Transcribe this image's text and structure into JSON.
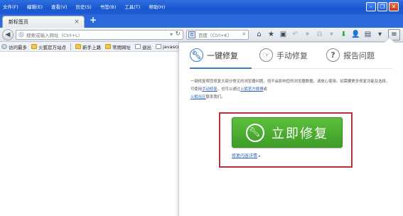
{
  "menu": [
    "文件(F)",
    "编辑(E)",
    "查看(V)",
    "历史(S)",
    "书签(B)",
    "工具(T)",
    "帮助(H)"
  ],
  "window_buttons": {
    "minimize": "–",
    "maximize": "❐",
    "close": "✕"
  },
  "tab": {
    "label": "新标签页",
    "close": "×",
    "new_tab": "+"
  },
  "nav": {
    "back": "◀",
    "url_placeholder": "搜索或输入网址（Ctrl+L）",
    "search_engine": "百",
    "search_placeholder": "百度（Ctrl+K）",
    "menu_button": "≡"
  },
  "bookmarks": [
    "访问最多",
    "火狐官方站点",
    "新手上路",
    "常用网址",
    "退出",
    "javascript"
  ],
  "panel": {
    "tabs": [
      {
        "label": "一键修复",
        "icon": "wrench-icon"
      },
      {
        "label": "手动修复",
        "icon": "hand-icon"
      },
      {
        "label": "报告问题",
        "icon": "question-icon"
      }
    ],
    "description": {
      "part1": "一键修复帮您修复大部分常见的浏览器问题，但不会影响您的浏览器数据。请放心使用。如需要更多修复功能及选择，可使用",
      "link1": "手动修复",
      "part2": "。也可以通过",
      "link2": "火狐官方微博",
      "part3": "或",
      "link3": "火狐社区",
      "part4": "联系我们。"
    },
    "repair_button": "立即修复",
    "help_link": "修复内容详情",
    "help_link_arrow": "▸"
  },
  "colors": {
    "accent": "#3b7ec6",
    "repair_green": "#4caf32",
    "highlight_red": "#b3333a",
    "titlebar_blue": "#1a57d0"
  }
}
